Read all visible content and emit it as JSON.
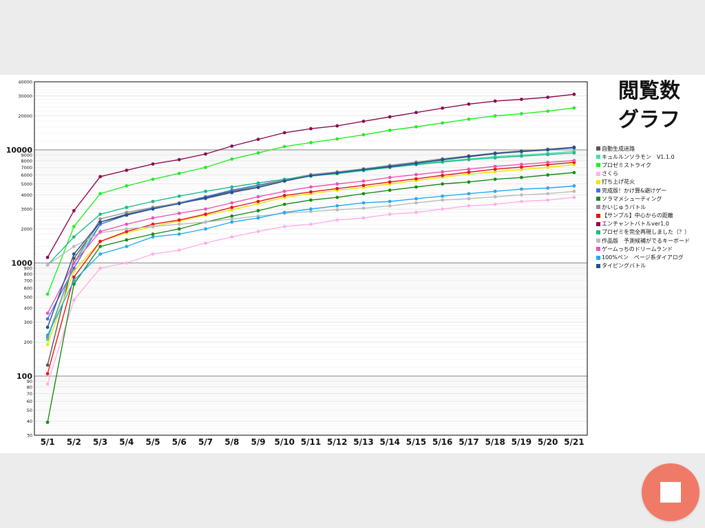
{
  "colors": {
    "background": "#ececec",
    "panel": "#ffffff",
    "grid": "#d4d4d4",
    "major_grid": "#9a9a9a",
    "stop_button": "#f07a68"
  },
  "stop_button": {
    "icon": "stop-icon"
  },
  "chart_data": {
    "type": "line",
    "title": "閲覧数グラフ",
    "title_lines": [
      "閲覧数",
      "グラフ"
    ],
    "y_scale": "log",
    "ylim": [
      30,
      40000
    ],
    "grid": true,
    "legend_position": "right",
    "x": [
      "5/1",
      "5/2",
      "5/3",
      "5/4",
      "5/5",
      "5/6",
      "5/7",
      "5/8",
      "5/9",
      "5/10",
      "5/11",
      "5/12",
      "5/13",
      "5/14",
      "5/15",
      "5/16",
      "5/17",
      "5/18",
      "5/19",
      "5/20",
      "5/21"
    ],
    "y_ticks": [
      {
        "value": 30,
        "label": "30"
      },
      {
        "value": 40,
        "label": "40"
      },
      {
        "value": 50,
        "label": "50"
      },
      {
        "value": 60,
        "label": "60"
      },
      {
        "value": 70,
        "label": "70"
      },
      {
        "value": 80,
        "label": "80"
      },
      {
        "value": 90,
        "label": "90"
      },
      {
        "value": 100,
        "label": "100"
      },
      {
        "value": 200,
        "label": "200"
      },
      {
        "value": 300,
        "label": "300"
      },
      {
        "value": 400,
        "label": "400"
      },
      {
        "value": 500,
        "label": "500"
      },
      {
        "value": 600,
        "label": "600"
      },
      {
        "value": 700,
        "label": "700"
      },
      {
        "value": 800,
        "label": "800"
      },
      {
        "value": 900,
        "label": "900"
      },
      {
        "value": 1000,
        "label": "1000"
      },
      {
        "value": 2000,
        "label": "2000"
      },
      {
        "value": 3000,
        "label": "3000"
      },
      {
        "value": 4000,
        "label": "4000"
      },
      {
        "value": 5000,
        "label": "5000"
      },
      {
        "value": 6000,
        "label": "6000"
      },
      {
        "value": 7000,
        "label": "7000"
      },
      {
        "value": 8000,
        "label": "8000"
      },
      {
        "value": 9000,
        "label": "9000"
      },
      {
        "value": 10000,
        "label": "10000"
      },
      {
        "value": 20000,
        "label": "20000"
      },
      {
        "value": 30000,
        "label": "30000"
      },
      {
        "value": 40000,
        "label": "40000"
      }
    ],
    "series": [
      {
        "name": "自動生成迷路",
        "color": "#555555",
        "values": [
          125,
          1100,
          2300,
          2700,
          3050,
          3400,
          3800,
          4300,
          4750,
          5400,
          6000,
          6300,
          6700,
          7100,
          7600,
          8150,
          8700,
          9250,
          9650,
          10000,
          10500
        ]
      },
      {
        "name": "キュルルンソラモン　V1.1.0",
        "color": "#40e0b0",
        "values": [
          210,
          1000,
          2200,
          2650,
          3050,
          3400,
          3850,
          4400,
          4850,
          5400,
          5850,
          6150,
          6550,
          7000,
          7500,
          7950,
          8300,
          8700,
          9000,
          9300,
          9700
        ]
      },
      {
        "name": "プロゼミストライク",
        "color": "#22ee22",
        "values": [
          530,
          2100,
          4100,
          4800,
          5500,
          6200,
          7000,
          8300,
          9400,
          10700,
          11600,
          12500,
          13600,
          14900,
          16000,
          17300,
          18700,
          20000,
          20900,
          22000,
          23500
        ]
      },
      {
        "name": "さくら",
        "color": "#ffb0e8",
        "values": [
          85,
          470,
          900,
          1000,
          1200,
          1300,
          1500,
          1700,
          1900,
          2100,
          2200,
          2400,
          2500,
          2700,
          2800,
          3000,
          3200,
          3300,
          3500,
          3600,
          3800
        ]
      },
      {
        "name": "打ち上げ花火",
        "color": "#e8e800",
        "values": [
          190,
          850,
          1550,
          1850,
          2100,
          2350,
          2650,
          2950,
          3350,
          3800,
          4100,
          4400,
          4650,
          5000,
          5350,
          5750,
          6100,
          6400,
          6700,
          7000,
          7400
        ]
      },
      {
        "name": "完成版！かけ算&避けゲー",
        "color": "#4a6fdc",
        "values": [
          320,
          900,
          2200,
          2650,
          3050,
          3400,
          3850,
          4400,
          4900,
          5400,
          5950,
          6300,
          6750,
          7200,
          7700,
          8250,
          8800,
          9350,
          9700,
          10050,
          10400
        ]
      },
      {
        "name": "ソラマメシューティング",
        "color": "#168c16",
        "values": [
          39,
          650,
          1400,
          1600,
          1800,
          2000,
          2300,
          2600,
          2900,
          3300,
          3600,
          3800,
          4100,
          4400,
          4700,
          5000,
          5200,
          5500,
          5700,
          6000,
          6300
        ]
      },
      {
        "name": "かいじゅうバトル",
        "color": "#909090",
        "values": [
          220,
          1000,
          2450,
          2800,
          3100,
          3400,
          3700,
          4200,
          4750,
          5450,
          6050,
          6400,
          6800,
          7300,
          7800,
          8350,
          8850,
          9400,
          9800,
          10150,
          10600
        ]
      },
      {
        "name": "【サンプル】中心からの距離",
        "color": "#ee1111",
        "values": [
          105,
          750,
          1550,
          1900,
          2200,
          2400,
          2700,
          3100,
          3500,
          3950,
          4250,
          4550,
          4850,
          5200,
          5550,
          5950,
          6350,
          6750,
          7050,
          7400,
          7750
        ]
      },
      {
        "name": "エンチャントバトルver1.0",
        "color": "#8b0a50",
        "values": [
          1120,
          2900,
          5800,
          6600,
          7500,
          8200,
          9200,
          10800,
          12400,
          14200,
          15400,
          16300,
          17900,
          19600,
          21400,
          23400,
          25400,
          27000,
          28000,
          29200,
          31000
        ]
      },
      {
        "name": "プロゼミを完全再現しました（？）",
        "color": "#20b888",
        "values": [
          960,
          1700,
          2700,
          3100,
          3500,
          3900,
          4300,
          4700,
          5100,
          5500,
          5900,
          6200,
          6600,
          7000,
          7400,
          7800,
          8200,
          8500,
          8800,
          9100,
          9400
        ]
      },
      {
        "name": "作品版　予測候補がでるキーボード",
        "color": "#bbbbbb",
        "values": [
          960,
          1400,
          1850,
          2000,
          2100,
          2200,
          2300,
          2450,
          2600,
          2750,
          2850,
          2950,
          3050,
          3200,
          3400,
          3600,
          3700,
          3850,
          4000,
          4100,
          4300
        ]
      },
      {
        "name": "ゲームっちのドリームランド",
        "color": "#e855b8",
        "values": [
          360,
          1000,
          1900,
          2200,
          2500,
          2750,
          3000,
          3400,
          3850,
          4300,
          4700,
          5000,
          5300,
          5700,
          6050,
          6400,
          6750,
          7150,
          7450,
          7750,
          8050
        ]
      },
      {
        "name": "100%ペン　ページ系ダイアログ",
        "color": "#22aaee",
        "values": [
          230,
          700,
          1200,
          1400,
          1700,
          1800,
          2000,
          2300,
          2500,
          2800,
          3000,
          3200,
          3400,
          3500,
          3700,
          3900,
          4100,
          4300,
          4500,
          4600,
          4800
        ]
      },
      {
        "name": "タイピングバトル",
        "color": "#1f4f8f",
        "values": [
          270,
          1200,
          2300,
          2650,
          3000,
          3350,
          3750,
          4200,
          4650,
          5300,
          5900,
          6250,
          6700,
          7100,
          7600,
          8200,
          8800,
          9300,
          9700,
          10050,
          10500
        ]
      }
    ]
  }
}
